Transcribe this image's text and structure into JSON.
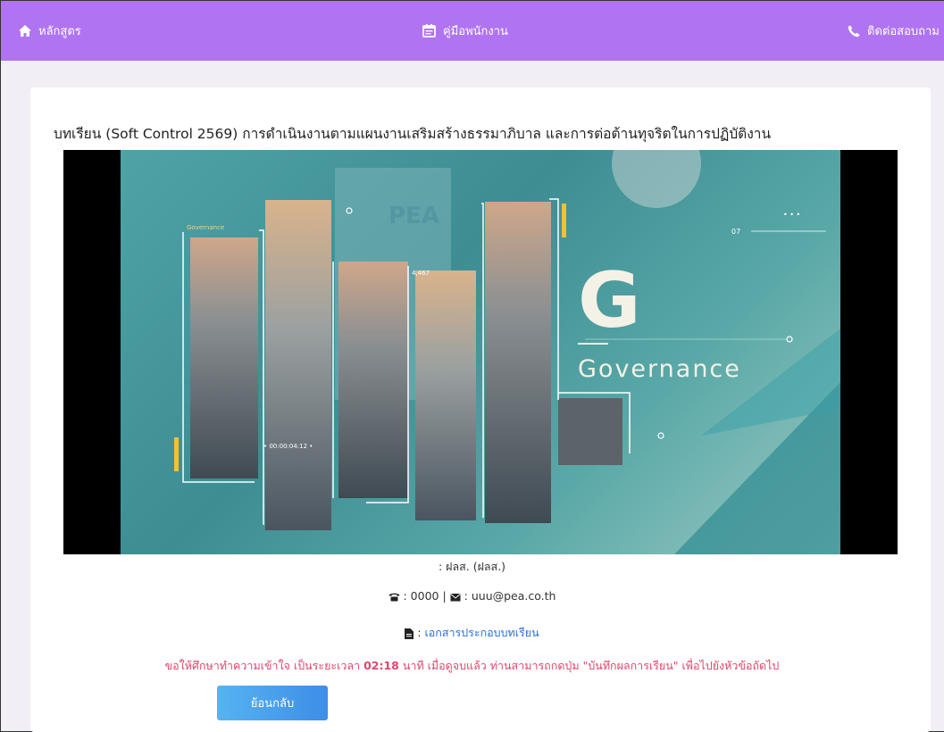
{
  "navbar": {
    "home_label": "หลักสูตร",
    "manual_label": "คู่มือพนักงาน",
    "contact_label": "ติดต่อสอบถาม"
  },
  "lesson": {
    "title": "บทเรียน (Soft Control 2569) การดำเนินงานตามแผนงานเสริมสร้างธรรมาภิบาล และการต่อต้านทุจริตในการปฏิบัติงาน"
  },
  "video": {
    "overlay_big_letter": "G",
    "overlay_word": "Governance",
    "overlay_small_tag": "Governance",
    "overlay_num": "07",
    "overlay_timer": "• 00:00:04:12 •",
    "overlay_value": "4,467",
    "overlay_building_sign": "PEA"
  },
  "info": {
    "owner": ": ฝลส. (ฝลส.)",
    "phone": ": 0000",
    "separator": "|",
    "email": ": uuu@pea.co.th",
    "doc_prefix": ":",
    "doc_link": "เอกสารประกอบบทเรียน"
  },
  "notice": {
    "part1": "ขอให้ศึกษาทำความเข้าใจ เป็นระยะเวลา",
    "duration": "02:18",
    "part2": "นาที เมื่อดูจบแล้ว ท่านสามารถกดปุ่ม \"บันทึกผลการเรียน\" เพื่อไปยังหัวข้อถัดไป"
  },
  "back_button": "ย้อนกลับ",
  "colors": {
    "navbar": "#b074f2",
    "notice": "#e2456c",
    "link": "#2a6fdb",
    "button": "#3d8ee8"
  }
}
